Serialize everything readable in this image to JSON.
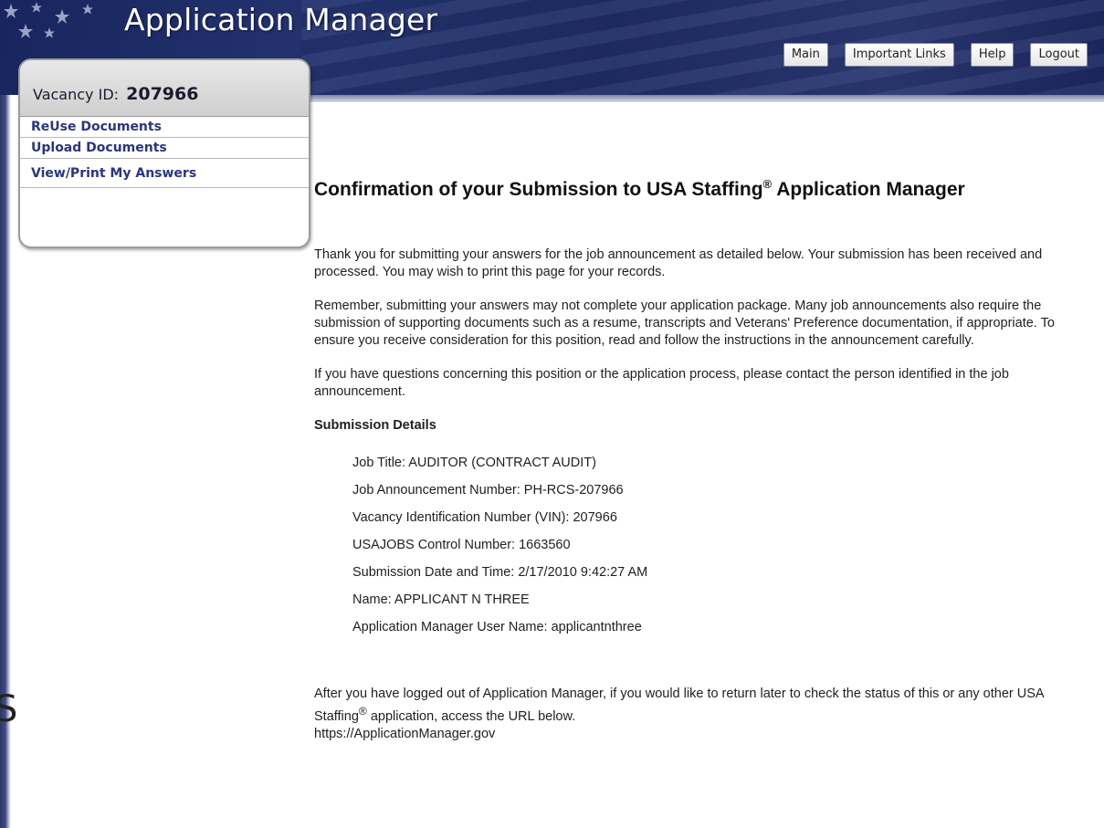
{
  "header": {
    "app_title": "Application Manager",
    "nav": [
      "Main",
      "Important Links",
      "Help",
      "Logout"
    ]
  },
  "sidebar": {
    "vacancy_label": "Vacancy ID:",
    "vacancy_id": "207966",
    "links": [
      "ReUse Documents",
      "Upload Documents",
      "View/Print My Answers"
    ]
  },
  "content": {
    "heading_pre": "Confirmation of your Submission to USA Staffing",
    "heading_reg": "®",
    "heading_post": " Application Manager",
    "para1": "Thank you for submitting your answers for the job announcement as detailed below. Your submission has been received and processed. You may wish to print this page for your records.",
    "para2": "Remember, submitting your answers may not complete your application package. Many job announcements also require the submission of supporting documents such as a resume, transcripts and Veterans' Preference documentation, if appropriate. To ensure you receive consideration for this position, read and follow the instructions in the announcement carefully.",
    "para3": "If you have questions concerning this position or the application process, please contact the person identified in the job announcement.",
    "details_heading": "Submission Details",
    "details": [
      "Job Title: AUDITOR (CONTRACT AUDIT)",
      "Job Announcement Number: PH-RCS-207966",
      "Vacancy Identification Number (VIN): 207966",
      "USAJOBS Control Number: 1663560",
      "Submission Date and Time: 2/17/2010 9:42:27 AM",
      "Name: APPLICANT N THREE",
      "Application Manager User Name: applicantnthree"
    ],
    "footer_pre": "After you have logged out of Application Manager, if you would like to return later to check the status of this or any other USA Staffing",
    "footer_reg": "®",
    "footer_post": " application, access the URL below.",
    "url": "https://ApplicationManager.gov"
  },
  "edge_glyph": "S",
  "colors": {
    "header_navy": "#1f2c66",
    "link_blue": "#2a3580",
    "panel_gray": "#cfcfcf"
  }
}
